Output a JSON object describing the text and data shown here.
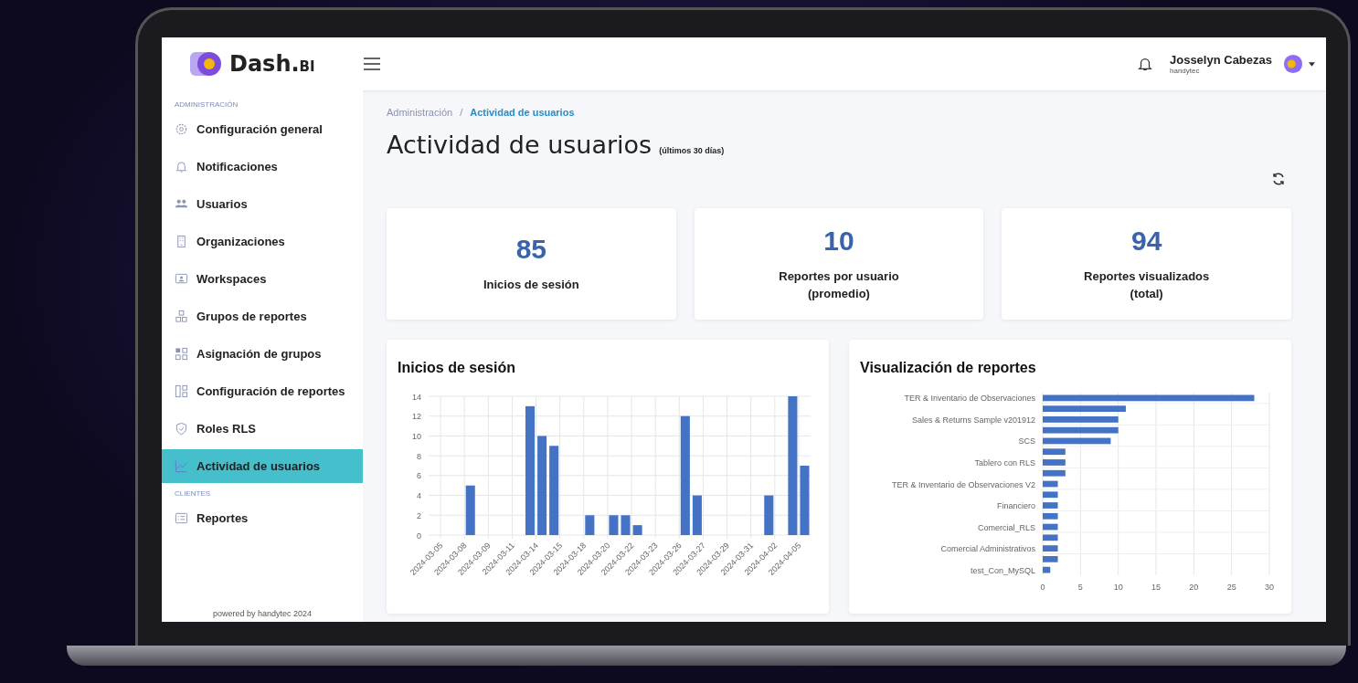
{
  "brand": {
    "name": "Dash.",
    "suffix": "BI"
  },
  "user": {
    "name": "Josselyn Cabezas",
    "org": "handytec"
  },
  "sidebar": {
    "sections": [
      {
        "heading": "ADMINISTRACIÓN",
        "items": [
          {
            "label": "Configuración general",
            "selected": false
          },
          {
            "label": "Notificaciones",
            "selected": false
          },
          {
            "label": "Usuarios",
            "selected": false
          },
          {
            "label": "Organizaciones",
            "selected": false
          },
          {
            "label": "Workspaces",
            "selected": false
          },
          {
            "label": "Grupos de reportes",
            "selected": false
          },
          {
            "label": "Asignación de grupos",
            "selected": false
          },
          {
            "label": "Configuración de reportes",
            "selected": false
          },
          {
            "label": "Roles RLS",
            "selected": false
          },
          {
            "label": "Actividad de usuarios",
            "selected": true
          }
        ]
      },
      {
        "heading": "CLIENTES",
        "items": [
          {
            "label": "Reportes",
            "selected": false
          }
        ]
      }
    ],
    "footer": "powered by handytec 2024"
  },
  "breadcrumb": {
    "items": [
      "Administración",
      "Actividad de usuarios"
    ],
    "separator": "/"
  },
  "page": {
    "title": "Actividad de usuarios",
    "subtitle": "(últimos 30 días)"
  },
  "stats": [
    {
      "value": "85",
      "label": "Inicios de sesión"
    },
    {
      "value": "10",
      "label": "Reportes por usuario (promedio)"
    },
    {
      "value": "94",
      "label": "Reportes visualizados (total)"
    }
  ],
  "charts": [
    {
      "title": "Inicios de sesión",
      "chart_data": {
        "type": "bar",
        "orientation": "vertical",
        "grid": true,
        "categories": [
          "2024-03-05",
          "2024-03-08",
          "2024-03-09",
          "2024-03-11",
          "2024-03-14",
          "2024-03-15",
          "2024-03-18",
          "2024-03-20",
          "2024-03-22",
          "2024-03-23",
          "2024-03-26",
          "2024-03-27",
          "2024-03-29",
          "2024-03-31",
          "2024-04-02",
          "2024-04-05"
        ],
        "stacked": false,
        "ylim": [
          0,
          14
        ],
        "yticks": [
          0,
          2,
          4,
          6,
          8,
          10,
          12,
          14
        ],
        "series": [
          {
            "color": "#4472c4",
            "values": [
              0,
              0,
              0,
              0,
              13,
              9,
              0,
              0,
              2,
              0,
              0,
              4,
              0,
              0,
              4,
              14
            ]
          },
          {
            "color": "#4472c4",
            "values": [
              0,
              5,
              0,
              0,
              10,
              0,
              2,
              2,
              1,
              0,
              12,
              0,
              0,
              0,
              0,
              7
            ]
          }
        ]
      }
    },
    {
      "title": "Visualización de reportes",
      "chart_data": {
        "type": "bar",
        "orientation": "horizontal",
        "grid": true,
        "categories": [
          "TER & Inventario de Observaciones",
          "Sales & Returns Sample v201912",
          "SCS",
          "Tablero con RLS",
          "TER & Inventario de Observaciones V2",
          "Financiero",
          "Comercial_RLS",
          "Comercial Administrativos",
          "test_Con_MySQL"
        ],
        "stacked": false,
        "xlim": [
          0,
          30
        ],
        "xticks": [
          0,
          5,
          10,
          15,
          20,
          25,
          30
        ],
        "series": [
          {
            "color": "#4472c4",
            "values": [
              28,
              10,
              9,
              3,
              2,
              2,
              2,
              2,
              1
            ]
          },
          {
            "color": "#4472c4",
            "values": [
              11,
              10,
              3,
              3,
              2,
              2,
              2,
              2,
              null
            ]
          }
        ]
      }
    }
  ]
}
